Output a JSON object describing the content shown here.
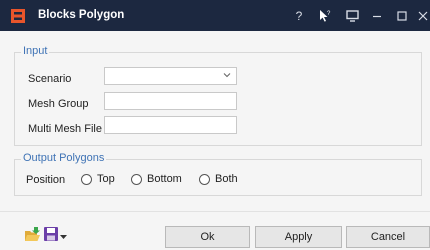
{
  "window": {
    "title": "Blocks Polygon",
    "help_glyph": "?",
    "icons": {
      "app": "grid-app-icon",
      "whatsthis": "whats-this-pointer-icon",
      "cast": "screen-icon",
      "minimize": "minimize-icon",
      "maximize": "maximize-icon",
      "close": "close-icon"
    },
    "colors": {
      "titlebar": "#1c2840",
      "group_title": "#3f73b5",
      "app_icon": "#e8552b"
    }
  },
  "input_group": {
    "title": "Input",
    "fields": {
      "scenario": {
        "label": "Scenario",
        "value": ""
      },
      "mesh_group": {
        "label": "Mesh Group",
        "value": ""
      },
      "multi_mesh_file": {
        "label": "Multi Mesh File",
        "value": ""
      }
    }
  },
  "output_group": {
    "title": "Output Polygons",
    "position_label": "Position",
    "options": [
      "Top",
      "Bottom",
      "Both"
    ]
  },
  "footer": {
    "icons": {
      "open": "open-folder-icon",
      "save": "save-disk-icon",
      "save_menu": "dropdown-arrow-icon"
    },
    "buttons": {
      "ok": "Ok",
      "apply": "Apply",
      "cancel": "Cancel"
    }
  }
}
